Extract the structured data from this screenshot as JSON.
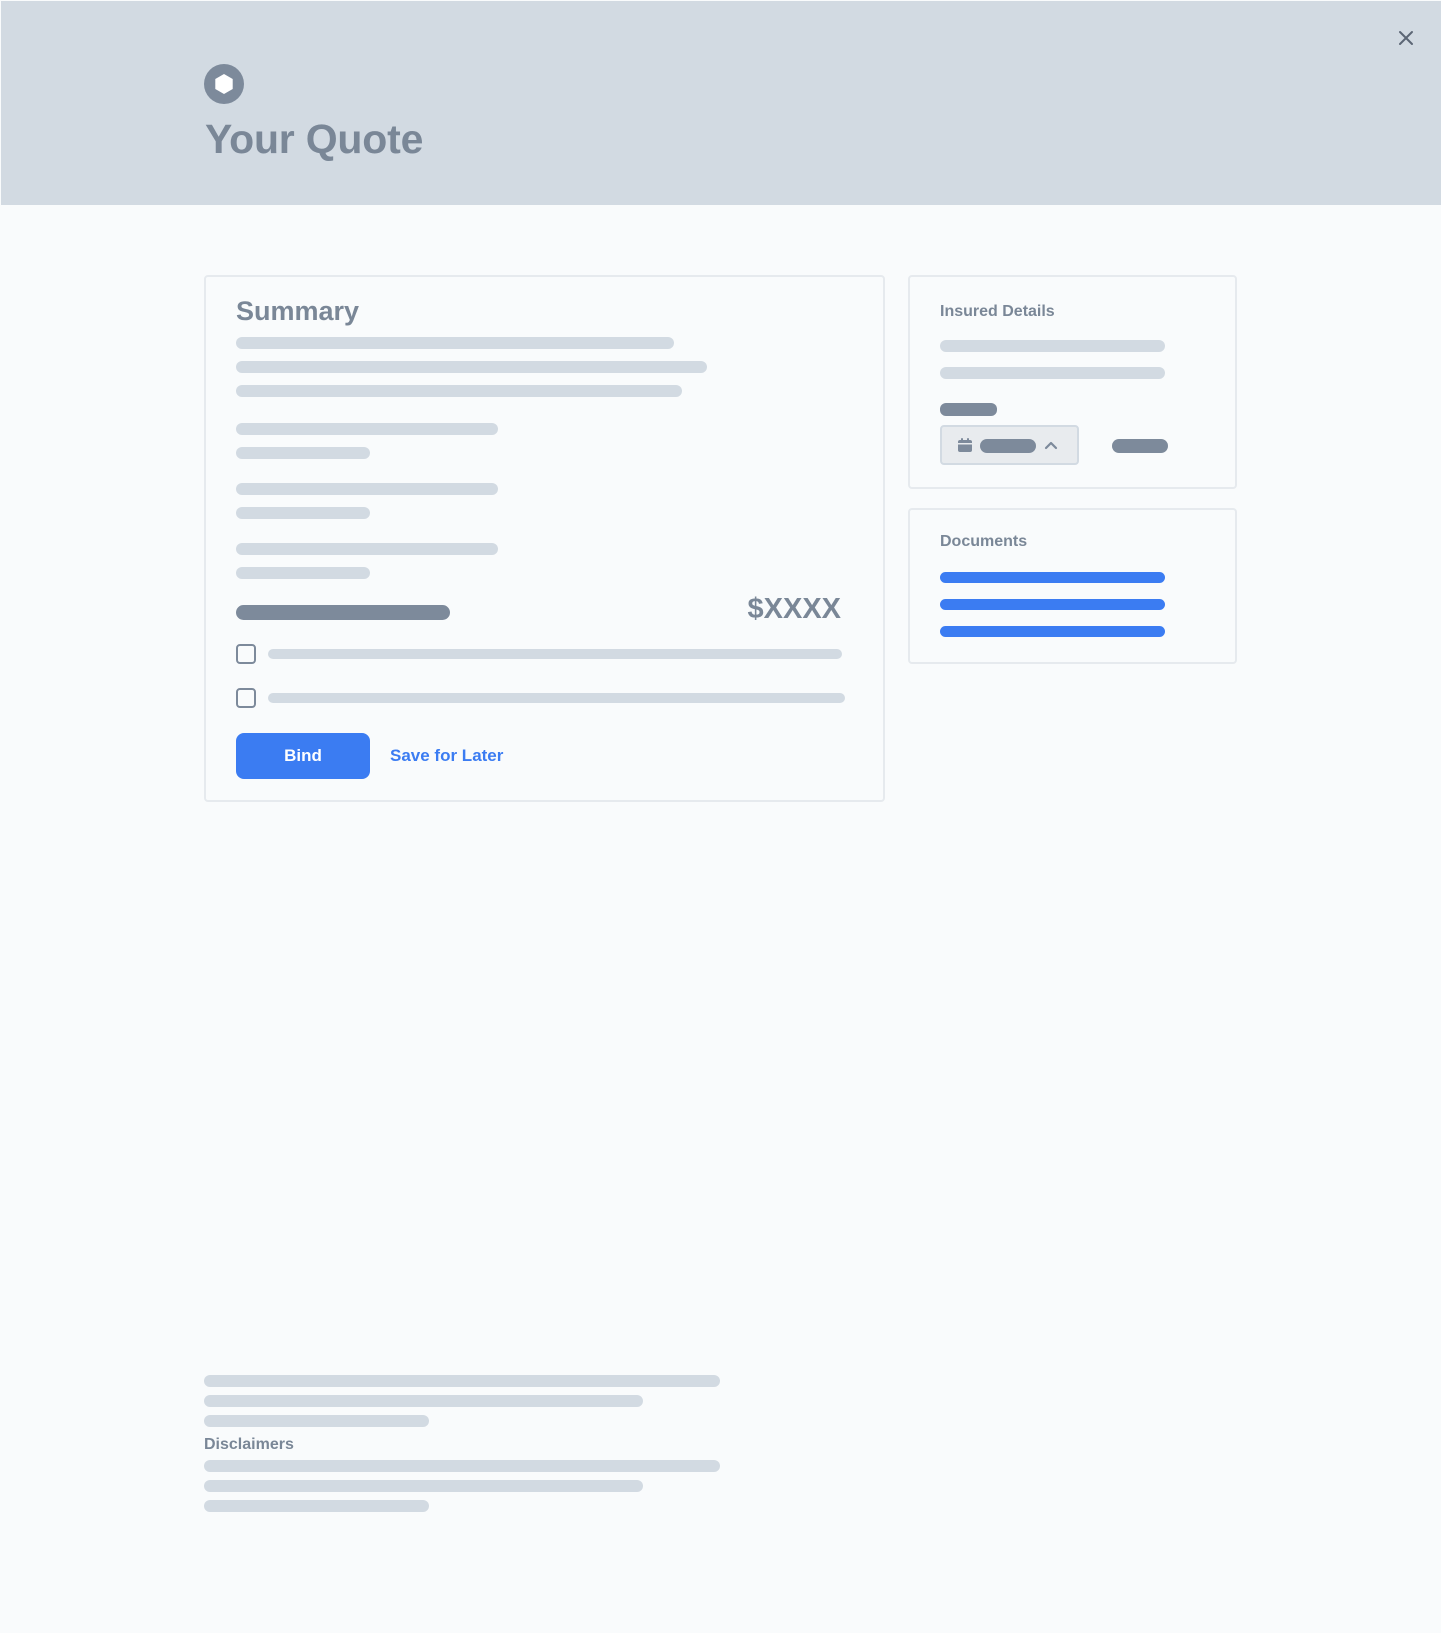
{
  "header": {
    "title": "Your Quote"
  },
  "summary": {
    "title": "Summary",
    "price": "$XXXX",
    "bind_label": "Bind",
    "save_label": "Save for Later"
  },
  "insured": {
    "title": "Insured Details"
  },
  "documents": {
    "title": "Documents"
  },
  "disclaimers": {
    "title": "Disclaimers"
  },
  "icons": {
    "logo": "hexagon-logo-icon",
    "close": "close-icon",
    "calendar": "calendar-icon",
    "chevron": "chevron-up-icon"
  },
  "colors": {
    "accent": "#3b7cf2",
    "header_bg": "#d2dae2",
    "heading_text": "#7a8797",
    "placeholder": "#d2dae2",
    "placeholder_dark": "#7d8a9b"
  }
}
